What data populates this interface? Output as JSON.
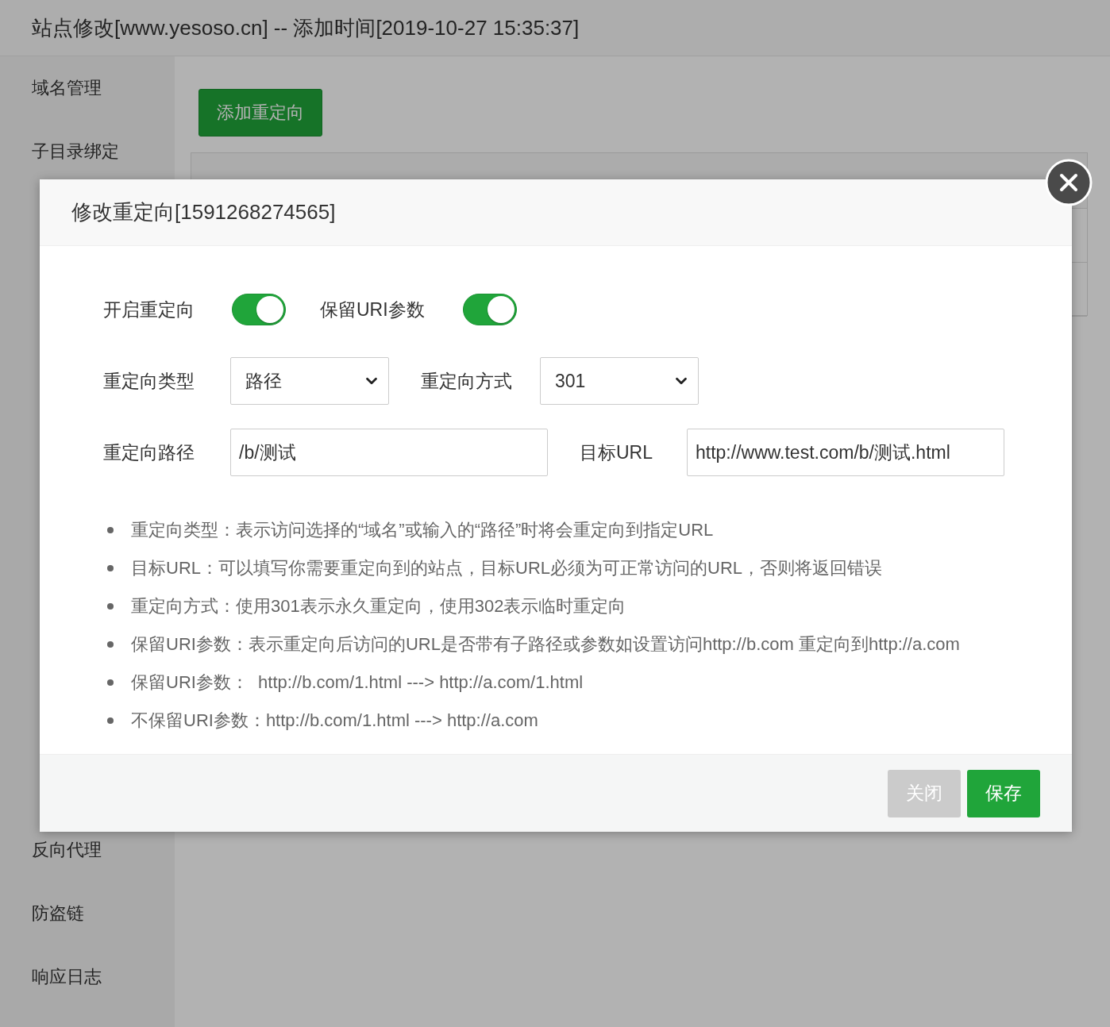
{
  "page": {
    "title": "站点修改[www.yesoso.cn] -- 添加时间[2019-10-27 15:35:37]"
  },
  "sidebar": {
    "top_items": [
      "域名管理",
      "子目录绑定"
    ],
    "bottom_items": [
      "反向代理",
      "防盗链",
      "响应日志"
    ]
  },
  "add_button": "添加重定向",
  "dialog": {
    "title": "修改重定向[1591268274565]",
    "switches": [
      {
        "label": "开启重定向",
        "on": true
      },
      {
        "label": "保留URI参数",
        "on": true
      }
    ],
    "selects": [
      {
        "label": "重定向类型",
        "value": "路径"
      },
      {
        "label": "重定向方式",
        "value": "301"
      }
    ],
    "inputs": [
      {
        "label": "重定向路径",
        "value": "/b/测试"
      },
      {
        "label": "目标URL",
        "value": "http://www.test.com/b/测试.html"
      }
    ],
    "notes": [
      "重定向类型：表示访问选择的“域名”或输入的“路径”时将会重定向到指定URL",
      "目标URL：可以填写你需要重定向到的站点，目标URL必须为可正常访问的URL，否则将返回错误",
      "重定向方式：使用301表示永久重定向，使用302表示临时重定向",
      "保留URI参数：表示重定向后访问的URL是否带有子路径或参数如设置访问http://b.com 重定向到http://a.com",
      "保留URI参数：  http://b.com/1.html ---> http://a.com/1.html",
      "不保留URI参数：http://b.com/1.html ---> http://a.com"
    ],
    "buttons": [
      {
        "label": "关闭",
        "kind": "secondary"
      },
      {
        "label": "保存",
        "kind": "primary"
      }
    ]
  }
}
